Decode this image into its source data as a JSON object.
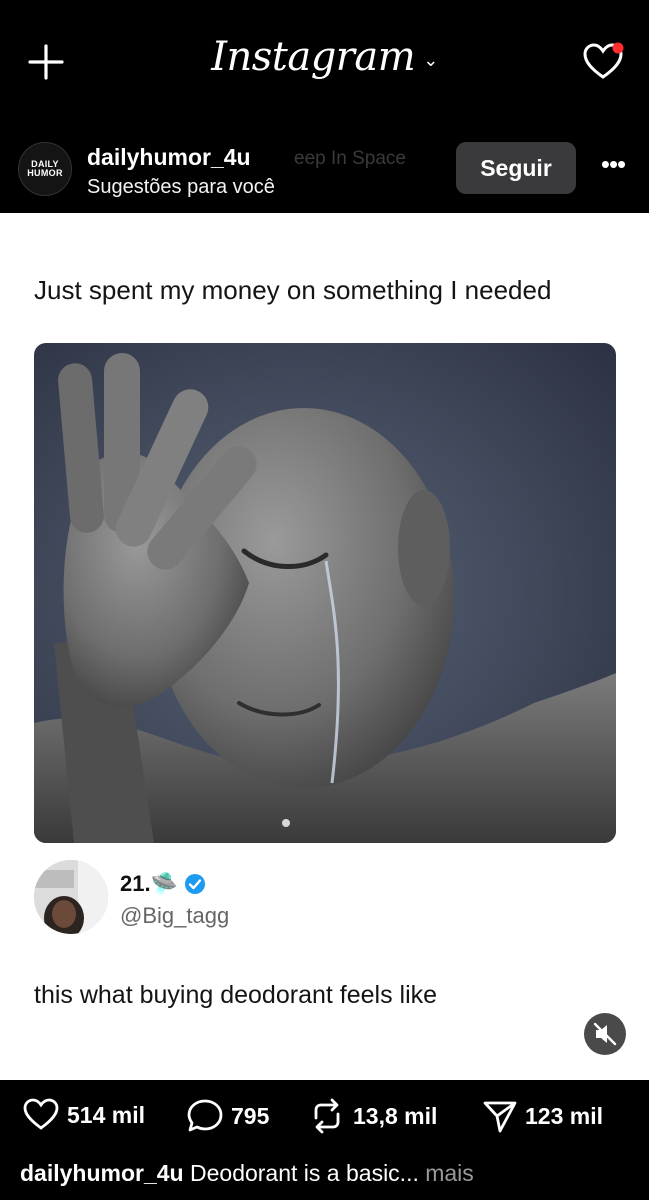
{
  "header": {
    "title": "Instagram",
    "title_chevron": "⌄"
  },
  "post_author": {
    "logo_line1": "DAILY",
    "logo_line2": "HUMOR",
    "username": "dailyhumor_4u",
    "ghost_text": "eep In Space",
    "subtitle": "Sugestões para você",
    "follow_label": "Seguir",
    "more_label": "•••"
  },
  "post": {
    "caption": "Just spent my money on something I needed",
    "tweet_author_name": "21.🛸",
    "tweet_handle": "@Big_tagg",
    "tweet_text": "this what buying deodorant feels like"
  },
  "actions": {
    "likes": "514 mil",
    "comments": "795",
    "reposts": "13,8 mil",
    "shares": "123 mil"
  },
  "bottom_caption": {
    "username": "dailyhumor_4u",
    "text": " Deodorant is a basic...",
    "more": " mais"
  },
  "colors": {
    "background": "#000000",
    "notification_dot": "#ff2d2d",
    "verified": "#1d9bf0",
    "follow_button": "#3a3a3c"
  }
}
